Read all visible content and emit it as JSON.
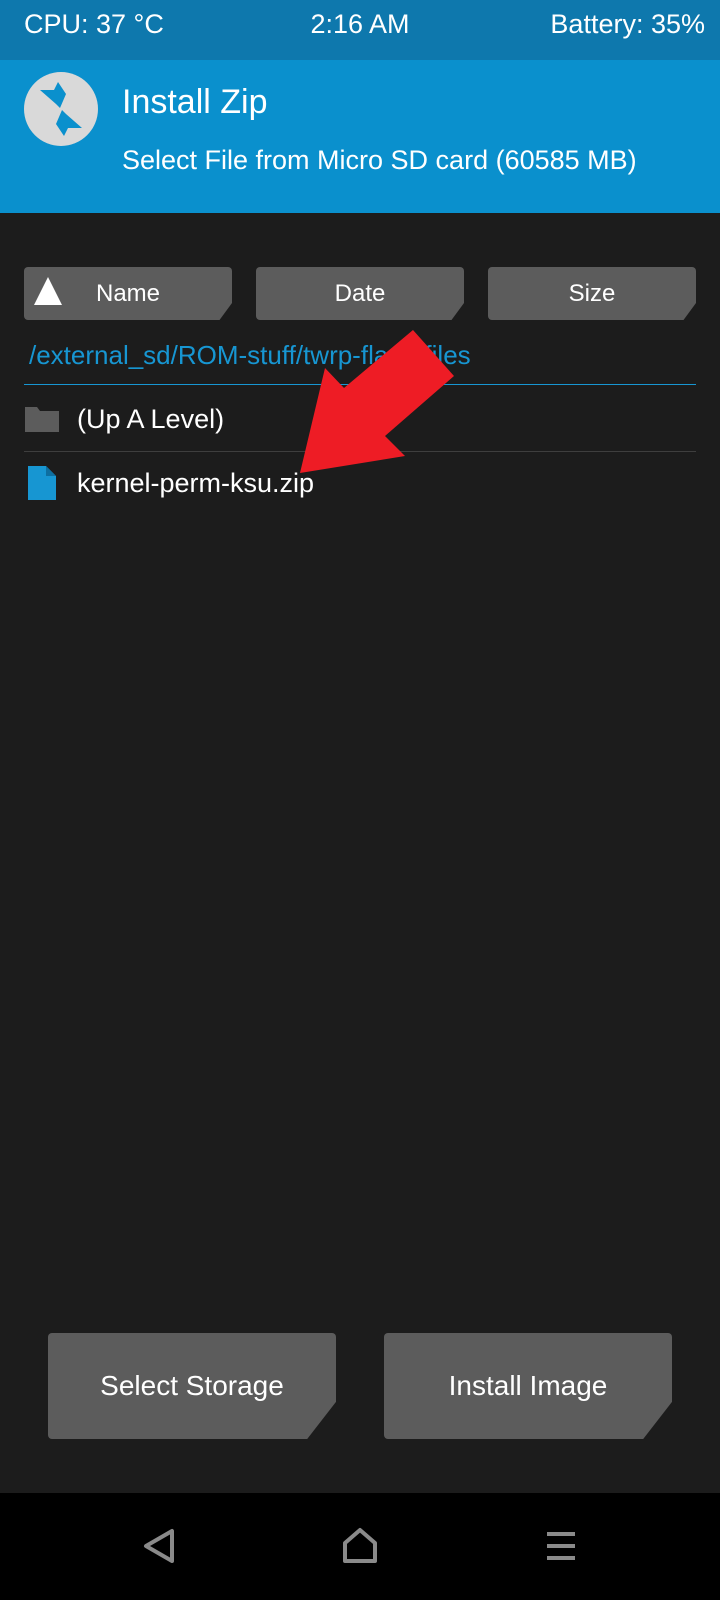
{
  "status_bar": {
    "cpu": "CPU: 37 °C",
    "time": "2:16 AM",
    "battery": "Battery: 35%"
  },
  "header": {
    "logo_icon": "twrp-logo-icon",
    "title": "Install Zip",
    "subtitle": "Select File from Micro SD card (60585 MB)"
  },
  "sort_buttons": {
    "name": "Name",
    "date": "Date",
    "size": "Size",
    "active_sort_icon": "sort-ascending-triangle-icon"
  },
  "current_path": "/external_sd/ROM-stuff/twrp-flash-files",
  "file_list": [
    {
      "type": "folder",
      "icon": "folder-icon",
      "label": "(Up A Level)"
    },
    {
      "type": "file",
      "icon": "file-icon",
      "label": "kernel-perm-ksu.zip"
    }
  ],
  "annotation": {
    "type": "red-arrow",
    "color": "#ee1c25",
    "points_to": "kernel-perm-ksu.zip"
  },
  "actions": {
    "select_storage": "Select Storage",
    "install_image": "Install Image"
  },
  "nav_bar": [
    "back-icon",
    "home-icon",
    "menu-icon"
  ],
  "colors": {
    "status_bar": "#0e78ad",
    "header": "#0a90cd",
    "background": "#1c1c1c",
    "button": "#5c5c5c",
    "accent": "#1796d2"
  }
}
